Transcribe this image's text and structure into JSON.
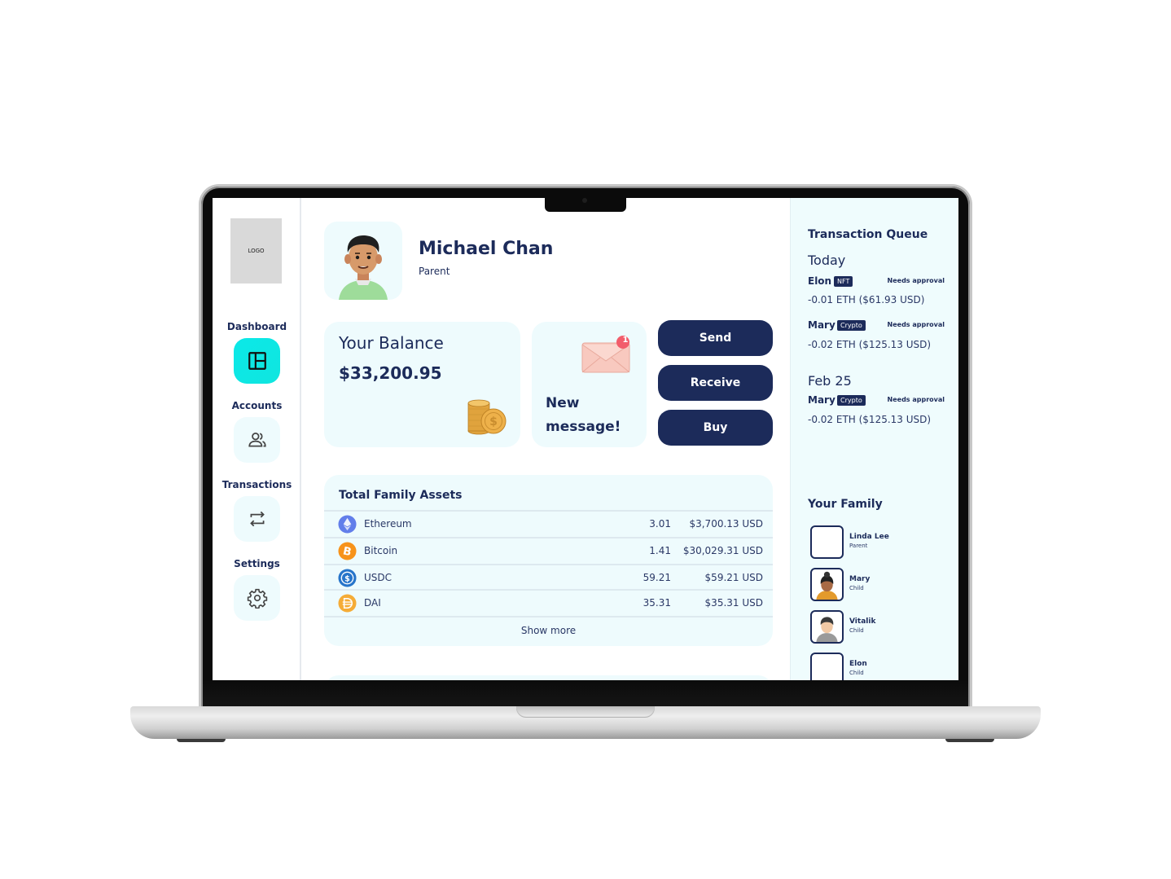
{
  "sidebar": {
    "logo_text": "LOGO",
    "items": [
      {
        "label": "Dashboard",
        "icon": "layout-icon",
        "active": true
      },
      {
        "label": "Accounts",
        "icon": "users-icon",
        "active": false
      },
      {
        "label": "Transactions",
        "icon": "swap-arrows-icon",
        "active": false
      },
      {
        "label": "Settings",
        "icon": "gear-icon",
        "active": false
      }
    ]
  },
  "profile": {
    "name": "Michael Chan",
    "role": "Parent"
  },
  "balance": {
    "title": "Your Balance",
    "value": "$33,200.95"
  },
  "message": {
    "text": "New message!",
    "badge_count": "1"
  },
  "actions": {
    "send": "Send",
    "receive": "Receive",
    "buy": "Buy"
  },
  "assets": {
    "title": "Total Family Assets",
    "rows": [
      {
        "name": "Ethereum",
        "icon": "ethereum-icon",
        "amount": "3.01",
        "value": "$3,700.13 USD",
        "color": "#627eea"
      },
      {
        "name": "Bitcoin",
        "icon": "bitcoin-icon",
        "amount": "1.41",
        "value": "$30,029.31 USD",
        "color": "#f7931a"
      },
      {
        "name": "USDC",
        "icon": "usdc-icon",
        "amount": "59.21",
        "value": "$59.21 USD",
        "color": "#2775ca"
      },
      {
        "name": "DAI",
        "icon": "dai-icon",
        "amount": "35.31",
        "value": "$35.31 USD",
        "color": "#f5ac37"
      }
    ],
    "show_more": "Show more"
  },
  "queue": {
    "title": "Transaction Queue",
    "groups": [
      {
        "date": "Today",
        "items": [
          {
            "name": "Elon",
            "tag": "NFT",
            "status": "Needs approval",
            "amount": "-0.01 ETH ($61.93 USD)"
          },
          {
            "name": "Mary",
            "tag": "Crypto",
            "status": "Needs approval",
            "amount": "-0.02 ETH ($125.13 USD)"
          }
        ]
      },
      {
        "date": "Feb 25",
        "items": [
          {
            "name": "Mary",
            "tag": "Crypto",
            "status": "Needs approval",
            "amount": "-0.02 ETH ($125.13 USD)"
          }
        ]
      }
    ]
  },
  "family": {
    "title": "Your Family",
    "members": [
      {
        "name": "Linda Lee",
        "role": "Parent"
      },
      {
        "name": "Mary",
        "role": "Child"
      },
      {
        "name": "Vitalik",
        "role": "Child"
      },
      {
        "name": "Elon",
        "role": "Child"
      }
    ]
  },
  "colors": {
    "navy": "#1c2b5a",
    "accent_cyan": "#0be8e8",
    "card_bg": "#eefbfd"
  }
}
